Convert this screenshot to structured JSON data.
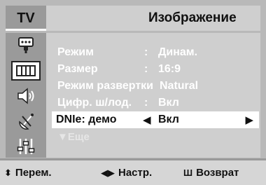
{
  "header": {
    "tv_label": "TV",
    "title": "Изображение"
  },
  "sidebar": {
    "icons": [
      {
        "name": "input-source-icon",
        "active": false
      },
      {
        "name": "picture-icon",
        "active": true
      },
      {
        "name": "sound-icon",
        "active": false
      },
      {
        "name": "antenna-channel-icon",
        "active": false
      },
      {
        "name": "setup-sliders-icon",
        "active": false
      }
    ]
  },
  "menu": {
    "items": [
      {
        "label": "Режим",
        "separator": ":",
        "value": "Динам."
      },
      {
        "label": "Размер",
        "separator": ":",
        "value": "16:9"
      },
      {
        "label": "Режим развертки",
        "separator": ":",
        "value": "Natural"
      },
      {
        "label": "Цифр. ш/лод.",
        "separator": ":",
        "value": "Вкл"
      },
      {
        "label": "DNIe: демо",
        "value": "Вкл",
        "arrow_left": "◀",
        "arrow_right": "▶"
      }
    ],
    "more_label": "Еще",
    "more_arrow": "▼"
  },
  "footer": {
    "move_symbol": "⬍",
    "move_label": "Перем.",
    "adjust_symbol": "◀▶",
    "adjust_label": "Настр.",
    "return_symbol": "Ш",
    "return_label": "Возврат"
  }
}
